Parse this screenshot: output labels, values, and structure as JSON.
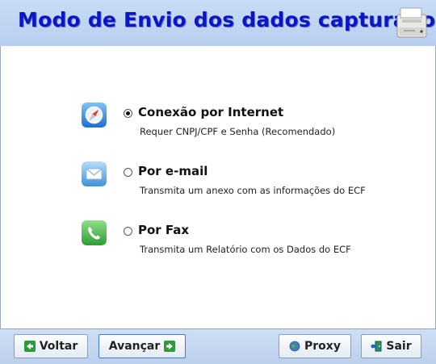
{
  "header": {
    "title": "Modo de Envio dos dados capturados",
    "icon": "printer-icon"
  },
  "options": [
    {
      "label": "Conexão por Internet",
      "description": "Requer CNPJ/CPF e Senha (Recomendado)",
      "selected": true,
      "icon": "safari-compass-icon"
    },
    {
      "label": "Por e-mail",
      "description": "Transmita um anexo com as informações do ECF",
      "selected": false,
      "icon": "mail-envelope-icon"
    },
    {
      "label": "Por Fax",
      "description": "Transmita um Relatório com os Dados do ECF",
      "selected": false,
      "icon": "phone-icon"
    }
  ],
  "footer": {
    "back_label": "Voltar",
    "next_label": "Avançar",
    "proxy_label": "Proxy",
    "exit_label": "Sair"
  },
  "colors": {
    "title": "#0a16c8",
    "header_bg": "#c9dcf6",
    "footer_bg": "#cfdff5"
  }
}
